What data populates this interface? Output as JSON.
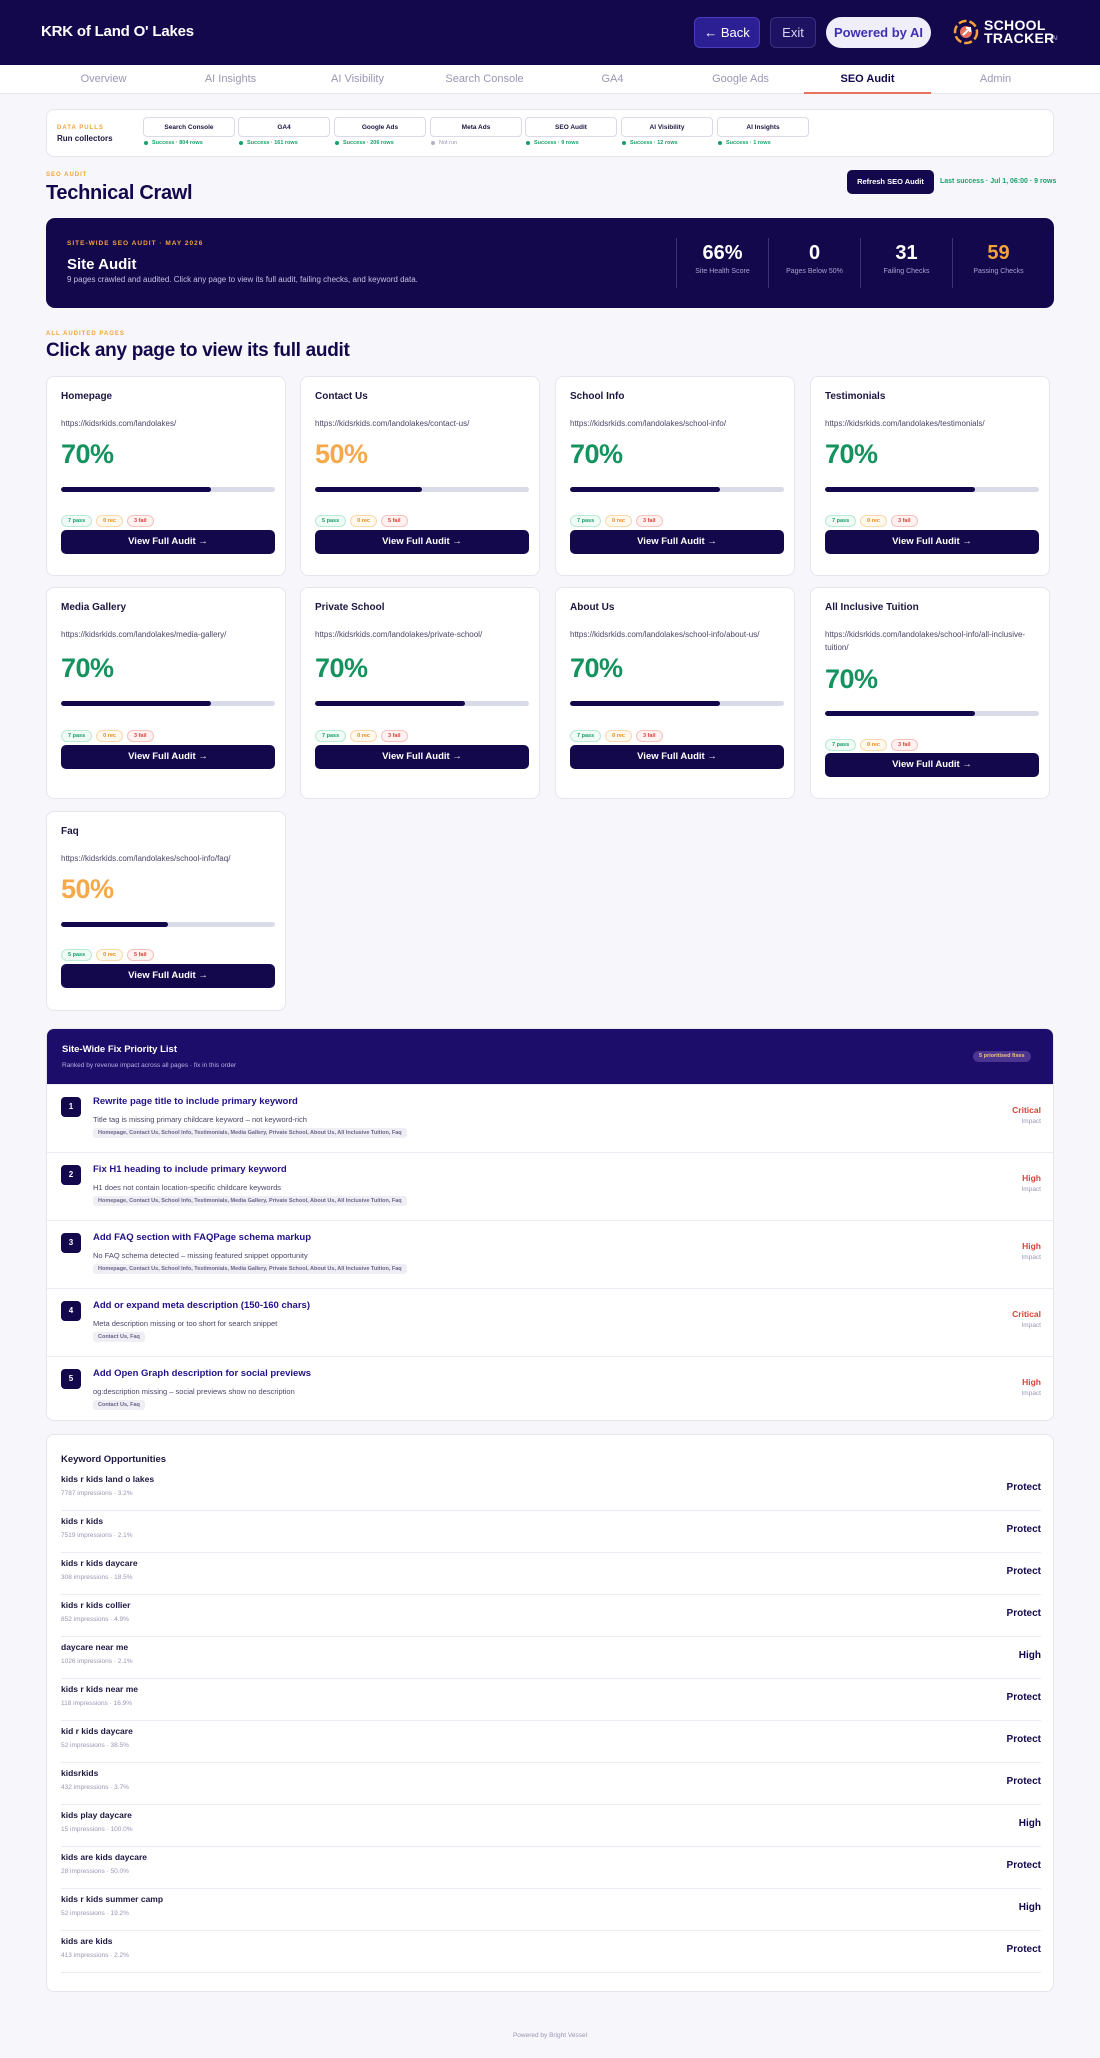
{
  "header": {
    "brand": "KRK of Land O' Lakes",
    "back_label": "← Back",
    "exit_label": "Exit",
    "ai_label": "Powered by AI",
    "logo_line1": "SCHOOL",
    "logo_line2": "TRACKER",
    "logo_sup": "AI"
  },
  "tabs": [
    "Overview",
    "AI Insights",
    "AI Visibility",
    "Search Console",
    "GA4",
    "Google Ads",
    "SEO Audit",
    "Admin"
  ],
  "active_tab": "SEO Audit",
  "data_pulls": {
    "eyebrow": "DATA PULLS",
    "title": "Run collectors",
    "items": [
      {
        "name": "Search Console",
        "status": "Success · 804 rows"
      },
      {
        "name": "GA4",
        "status": "Success · 161 rows"
      },
      {
        "name": "Google Ads",
        "status": "Success · 206 rows"
      },
      {
        "name": "Meta Ads",
        "status": "Not run"
      },
      {
        "name": "SEO Audit",
        "status": "Success · 9 rows"
      },
      {
        "name": "AI Visibility",
        "status": "Success · 12 rows"
      },
      {
        "name": "AI Insights",
        "status": "Success · 1 rows"
      }
    ]
  },
  "crawl": {
    "eyebrow": "SEO AUDIT",
    "title": "Technical Crawl",
    "refresh_label": "Refresh SEO Audit",
    "last_success": "Last success · Jul 1, 06:00 · 9 rows"
  },
  "hero": {
    "eyebrow": "SITE-WIDE SEO AUDIT · MAY 2026",
    "title": "Site Audit",
    "subtitle": "9 pages crawled and audited. Click any page to view its full audit, failing checks, and keyword data.",
    "stats": [
      {
        "value": "66%",
        "label": "Site Health Score"
      },
      {
        "value": "0",
        "label": "Pages Below 50%"
      },
      {
        "value": "31",
        "label": "Failing Checks"
      },
      {
        "value": "59",
        "label": "Passing Checks"
      }
    ]
  },
  "pages_section": {
    "eyebrow": "ALL AUDITED PAGES",
    "title": "Click any page to view its full audit"
  },
  "pages": [
    {
      "title": "Homepage",
      "url": "https://kidsrkids.com/landolakes/",
      "score": "70%",
      "score_value": 70,
      "pass": "7 pass",
      "rec": "0 rec",
      "fail": "3 fail",
      "button": "View Full Audit →"
    },
    {
      "title": "Contact Us",
      "url": "https://kidsrkids.com/landolakes/contact-us/",
      "score": "50%",
      "score_value": 50,
      "pass": "5 pass",
      "rec": "0 rec",
      "fail": "5 fail",
      "button": "View Full Audit →"
    },
    {
      "title": "School Info",
      "url": "https://kidsrkids.com/landolakes/school-info/",
      "score": "70%",
      "score_value": 70,
      "pass": "7 pass",
      "rec": "0 rec",
      "fail": "3 fail",
      "button": "View Full Audit →"
    },
    {
      "title": "Testimonials",
      "url": "https://kidsrkids.com/landolakes/testimonials/",
      "score": "70%",
      "score_value": 70,
      "pass": "7 pass",
      "rec": "0 rec",
      "fail": "3 fail",
      "button": "View Full Audit →"
    },
    {
      "title": "Media Gallery",
      "url": "https://kidsrkids.com/landolakes/media-gallery/",
      "score": "70%",
      "score_value": 70,
      "pass": "7 pass",
      "rec": "0 rec",
      "fail": "3 fail",
      "button": "View Full Audit →"
    },
    {
      "title": "Private School",
      "url": "https://kidsrkids.com/landolakes/private-school/",
      "score": "70%",
      "score_value": 70,
      "pass": "7 pass",
      "rec": "0 rec",
      "fail": "3 fail",
      "button": "View Full Audit →"
    },
    {
      "title": "About Us",
      "url": "https://kidsrkids.com/landolakes/school-info/about-us/",
      "score": "70%",
      "score_value": 70,
      "pass": "7 pass",
      "rec": "0 rec",
      "fail": "3 fail",
      "button": "View Full Audit →"
    },
    {
      "title": "All Inclusive Tuition",
      "url": "https://kidsrkids.com/landolakes/school-info/all-inclusive-tuition/",
      "score": "70%",
      "score_value": 70,
      "pass": "7 pass",
      "rec": "0 rec",
      "fail": "3 fail",
      "button": "View Full Audit →"
    },
    {
      "title": "Faq",
      "url": "https://kidsrkids.com/landolakes/school-info/faq/",
      "score": "50%",
      "score_value": 50,
      "pass": "5 pass",
      "rec": "0 rec",
      "fail": "5 fail",
      "button": "View Full Audit →"
    }
  ],
  "priority": {
    "title": "Site-Wide Fix Priority List",
    "subtitle": "Ranked by revenue impact across all pages · fix in this order",
    "badge": "5 prioritised fixes",
    "impact_label": "Impact",
    "items": [
      {
        "num": "1",
        "title": "Rewrite page title to include primary keyword",
        "desc": "Title tag is missing primary childcare keyword – not keyword-rich",
        "pages": "Homepage, Contact Us, School Info, Testimonials, Media Gallery, Private School, About Us, All Inclusive Tuition, Faq",
        "level": "Critical"
      },
      {
        "num": "2",
        "title": "Fix H1 heading to include primary keyword",
        "desc": "H1 does not contain location-specific childcare keywords",
        "pages": "Homepage, Contact Us, School Info, Testimonials, Media Gallery, Private School, About Us, All Inclusive Tuition, Faq",
        "level": "High"
      },
      {
        "num": "3",
        "title": "Add FAQ section with FAQPage schema markup",
        "desc": "No FAQ schema detected – missing featured snippet opportunity",
        "pages": "Homepage, Contact Us, School Info, Testimonials, Media Gallery, Private School, About Us, All Inclusive Tuition, Faq",
        "level": "High"
      },
      {
        "num": "4",
        "title": "Add or expand meta description (150-160 chars)",
        "desc": "Meta description missing or too short for search snippet",
        "pages": "Contact Us, Faq",
        "level": "Critical"
      },
      {
        "num": "5",
        "title": "Add Open Graph description for social previews",
        "desc": "og:description missing – social previews show no description",
        "pages": "Contact Us, Faq",
        "level": "High"
      }
    ]
  },
  "keywords": {
    "title": "Keyword Opportunities",
    "items": [
      {
        "name": "kids r kids land o lakes",
        "meta": "7787 impressions · 3.2%",
        "tag": "Protect"
      },
      {
        "name": "kids r kids",
        "meta": "7519 impressions · 2.1%",
        "tag": "Protect"
      },
      {
        "name": "kids r kids daycare",
        "meta": "308 impressions · 18.5%",
        "tag": "Protect"
      },
      {
        "name": "kids r kids collier",
        "meta": "852 impressions · 4.9%",
        "tag": "Protect"
      },
      {
        "name": "daycare near me",
        "meta": "1026 impressions · 2.1%",
        "tag": "High"
      },
      {
        "name": "kids r kids near me",
        "meta": "118 impressions · 16.9%",
        "tag": "Protect"
      },
      {
        "name": "kid r kids daycare",
        "meta": "52 impressions · 38.5%",
        "tag": "Protect"
      },
      {
        "name": "kidsrkids",
        "meta": "432 impressions · 3.7%",
        "tag": "Protect"
      },
      {
        "name": "kids play daycare",
        "meta": "15 impressions · 100.0%",
        "tag": "High"
      },
      {
        "name": "kids are kids daycare",
        "meta": "28 impressions · 50.0%",
        "tag": "Protect"
      },
      {
        "name": "kids r kids summer camp",
        "meta": "52 impressions · 19.2%",
        "tag": "High"
      },
      {
        "name": "kids are kids",
        "meta": "413 impressions · 2.2%",
        "tag": "Protect"
      }
    ]
  },
  "footer": "Powered by Bright Vessel",
  "colors": {
    "navy": "#13084c",
    "success": "#14935e",
    "warning": "#f5a94a",
    "danger": "#d8443a",
    "accent": "#e8715d"
  }
}
